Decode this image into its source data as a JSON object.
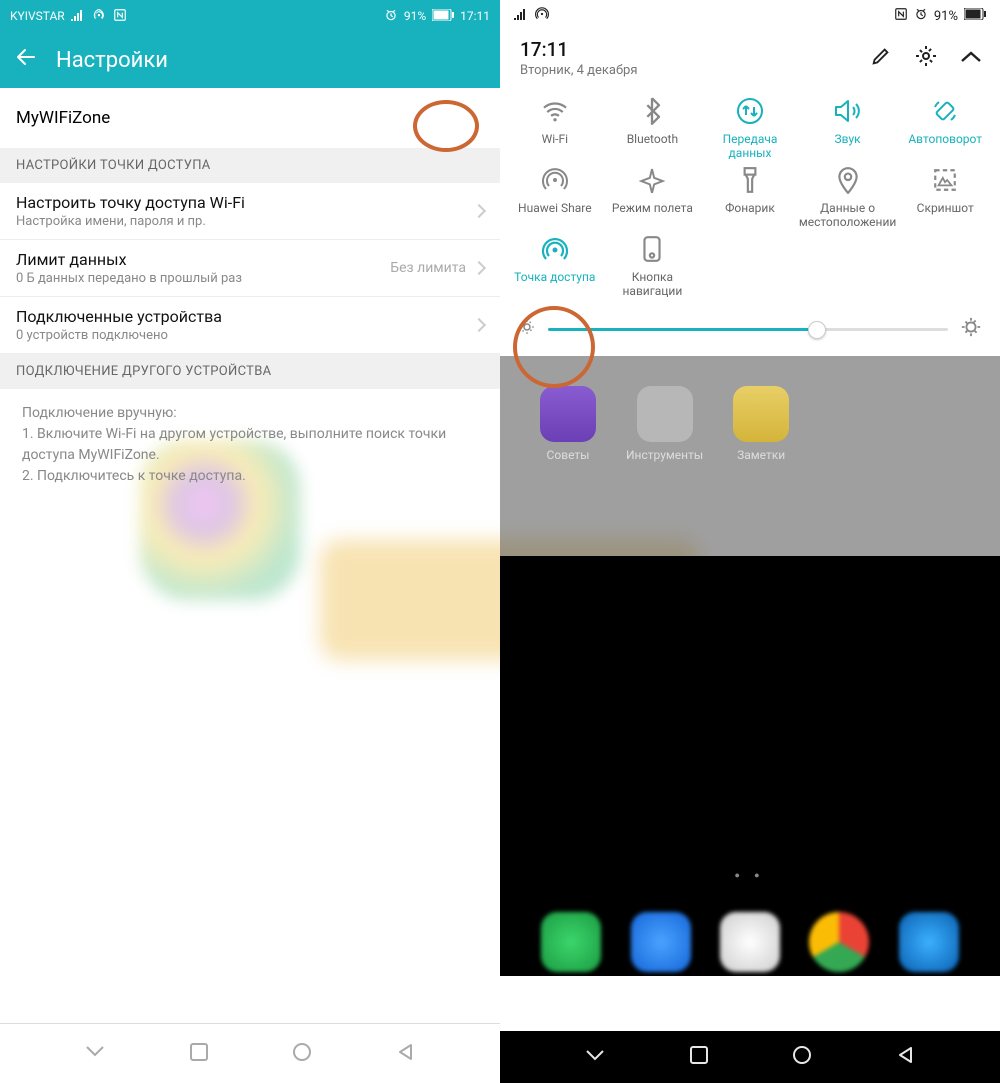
{
  "left": {
    "status": {
      "carrier": "KYIVSTAR",
      "battery": "91%",
      "time": "17:11"
    },
    "header": "Настройки",
    "wifi_name": "MyWIFiZone",
    "section_ap": "НАСТРОЙКИ ТОЧКИ ДОСТУПА",
    "items": [
      {
        "title": "Настроить точку доступа Wi-Fi",
        "sub": "Настройка имени, пароля и пр.",
        "value": ""
      },
      {
        "title": "Лимит данных",
        "sub": "0 Б данных передано в прошлый раз",
        "value": "Без лимита"
      },
      {
        "title": "Подключенные устройства",
        "sub": "0 устройств подключено",
        "value": ""
      }
    ],
    "section_conn": "ПОДКЛЮЧЕНИЕ ДРУГОГО УСТРОЙСТВА",
    "note_heading": "Подключение вручную:",
    "note_1": "1. Включите Wi-Fi на другом устройстве, выполните поиск точки доступа MyWIFiZone.",
    "note_2": "2. Подключитесь к точке доступа."
  },
  "right": {
    "status": {
      "battery": "91%"
    },
    "time": "17:11",
    "date": "Вторник, 4 декабря",
    "tiles": [
      {
        "label": "Wi-Fi",
        "active": false,
        "icon": "wifi"
      },
      {
        "label": "Bluetooth",
        "active": false,
        "icon": "bluetooth"
      },
      {
        "label": "Передача данных",
        "active": true,
        "icon": "data"
      },
      {
        "label": "Звук",
        "active": true,
        "icon": "sound"
      },
      {
        "label": "Автоповорот",
        "active": true,
        "icon": "rotate"
      },
      {
        "label": "Huawei Share",
        "active": false,
        "icon": "share"
      },
      {
        "label": "Режим полета",
        "active": false,
        "icon": "airplane"
      },
      {
        "label": "Фонарик",
        "active": false,
        "icon": "torch"
      },
      {
        "label": "Данные о местоположении",
        "active": false,
        "icon": "location"
      },
      {
        "label": "Скриншот",
        "active": false,
        "icon": "screenshot"
      },
      {
        "label": "Точка доступа",
        "active": true,
        "icon": "hotspot"
      },
      {
        "label": "Кнопка навигации",
        "active": false,
        "icon": "navkey"
      }
    ],
    "blur_apps": [
      "Советы",
      "Инструменты",
      "Заметки"
    ]
  },
  "colors": {
    "accent": "#17b2bd",
    "highlight": "#cc6633"
  }
}
